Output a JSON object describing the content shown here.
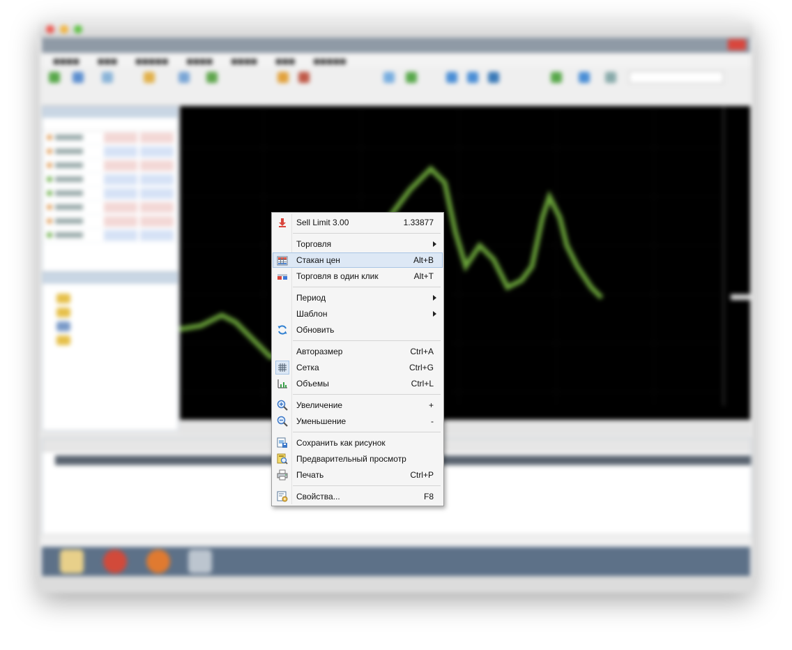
{
  "context_menu": {
    "items": [
      {
        "label": "Sell Limit 3.00",
        "shortcut": "1.33877",
        "icon": "sell-arrow-icon"
      },
      {
        "label": "Торговля",
        "submenu": true
      },
      {
        "label": "Стакан цен",
        "shortcut": "Alt+B",
        "icon": "depth-of-market-icon",
        "highlighted": true
      },
      {
        "label": "Торговля в один клик",
        "shortcut": "Alt+T",
        "icon": "one-click-trading-icon"
      },
      {
        "label": "Период",
        "submenu": true
      },
      {
        "label": "Шаблон",
        "submenu": true
      },
      {
        "label": "Обновить",
        "icon": "refresh-icon"
      },
      {
        "label": "Авторазмер",
        "shortcut": "Ctrl+A"
      },
      {
        "label": "Сетка",
        "shortcut": "Ctrl+G",
        "icon": "grid-icon",
        "checked": true
      },
      {
        "label": "Объемы",
        "shortcut": "Ctrl+L",
        "icon": "volumes-icon"
      },
      {
        "label": "Увеличение",
        "shortcut": "+",
        "icon": "zoom-in-icon"
      },
      {
        "label": "Уменьшение",
        "shortcut": "-",
        "icon": "zoom-out-icon"
      },
      {
        "label": "Сохранить как рисунок",
        "icon": "save-picture-icon"
      },
      {
        "label": "Предварительный просмотр",
        "icon": "print-preview-icon"
      },
      {
        "label": "Печать",
        "shortcut": "Ctrl+P",
        "icon": "printer-icon"
      },
      {
        "label": "Свойства...",
        "shortcut": "F8",
        "icon": "properties-icon"
      }
    ]
  },
  "colors": {
    "chart_background": "#000000",
    "candles": "#6aa33a",
    "menu_highlight": "#dde8f5",
    "sell_arrow": "#d9463d"
  }
}
